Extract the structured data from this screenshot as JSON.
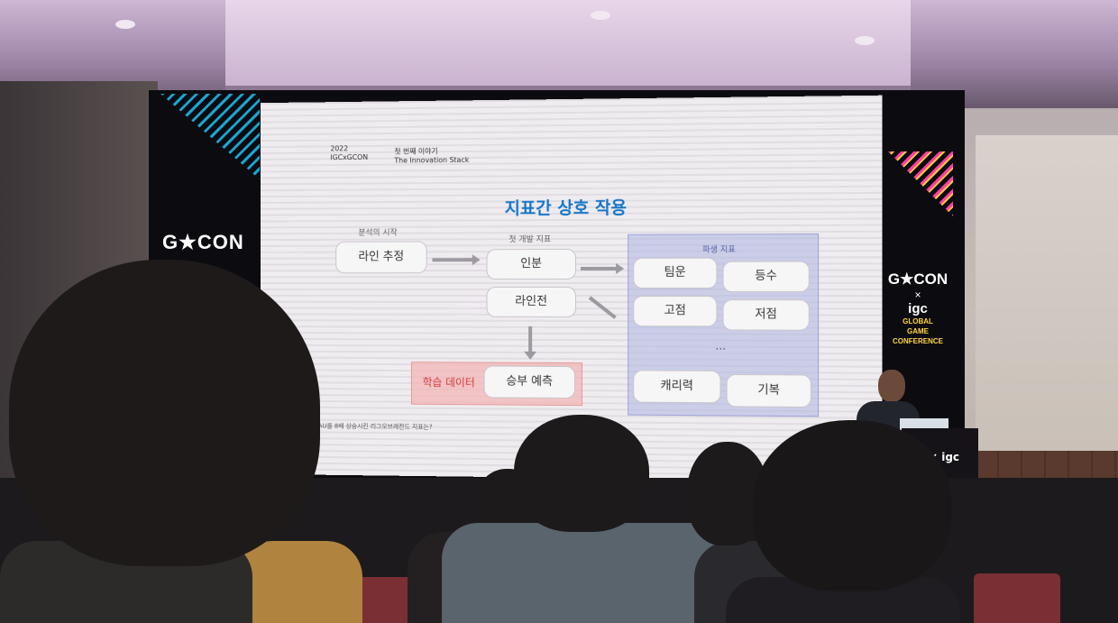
{
  "stage": {
    "logo_left": "G★CON",
    "logo_right_top": "G★CON",
    "logo_right_x": "×",
    "logo_right_igc": "igc",
    "logo_right_line1": "GLOBAL",
    "logo_right_line2": "GAME CONFERENCE",
    "podium_logo": "× igc"
  },
  "slide": {
    "year_line1": "2022",
    "year_line2": "IGCxGCON",
    "chapter_line1": "첫 번째 이야기",
    "chapter_line2": "The Innovation Stack",
    "title": "지표간 상호 작용",
    "caption_start": "분석의 시작",
    "caption_first": "첫 개발 지표",
    "caption_derived": "파생 지표",
    "box_line_estimate": "라인 추정",
    "box_inbun": "인분",
    "box_line_battle": "라인전",
    "box_learning_label": "학습 데이터",
    "box_win_predict": "승부 예측",
    "box_timun": "팀운",
    "box_deungsu": "등수",
    "box_gojeom": "고점",
    "box_jeojeom": "저점",
    "dots": "...",
    "box_character": "캐리력",
    "box_gibok": "기복",
    "footnote": "MAU를 8배 상승시킨 리그오브레전드 지표는?"
  }
}
